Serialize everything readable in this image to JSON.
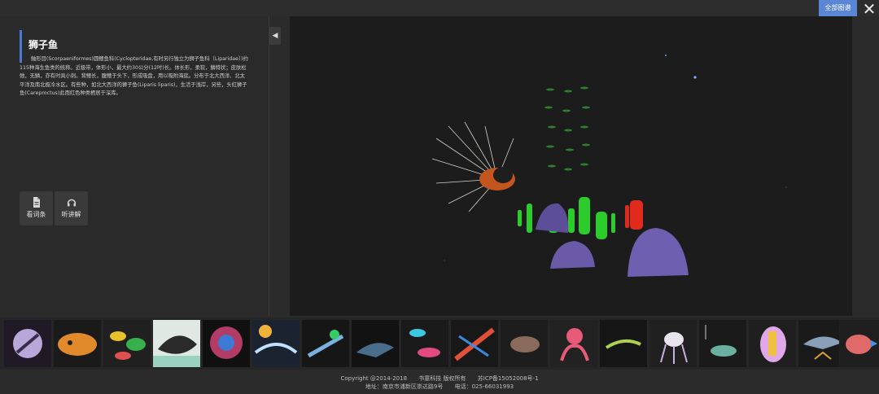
{
  "header": {
    "all_button_label": "全部图谱",
    "close_icon": "close-icon"
  },
  "species": {
    "title": "狮子鱼",
    "description": "鲉形目(Scorpaeniformes)圆鳍鱼科(Cyclopteridae,有时另行独立为狮子鱼科〔Liparidae〕)约115种海生鱼类的统称。近极带，体形小，最大约30公分(12吋)长。体长形，柔软，鳞特状；皮肤松弛，无鳞，亦有时具小刺。背鳍长，腹鳍于头下，形成吸盘，用以吸附海底。分布于北大西洋、北太平洋及南北极冷水区。有些种，如北大西洋的狮子鱼(Liparis liparis)，生活于浅岸，另些，头红狮子鱼(Careproctus)此而红色种类栖居于深库。"
  },
  "actions": [
    {
      "label": "看词条",
      "icon": "document-icon"
    },
    {
      "label": "听讲解",
      "icon": "headphones-icon"
    }
  ],
  "collapse_icon": "chevron-left-icon",
  "thumbnails": [
    "thumb-1",
    "thumb-2",
    "thumb-3",
    "thumb-4",
    "thumb-5",
    "thumb-6",
    "thumb-7",
    "thumb-8",
    "thumb-9",
    "thumb-10",
    "thumb-11",
    "thumb-12",
    "thumb-13",
    "thumb-14",
    "thumb-15",
    "thumb-16",
    "thumb-17",
    "thumb-18"
  ],
  "footer": {
    "copyright": "Copyright @2014-2018",
    "company": "书童科技 版权所有",
    "icp": "苏ICP备15052008号-1",
    "address": "地址：南京市浦新区崇达路9号",
    "phone": "电话：025-66031993"
  },
  "colors": {
    "accent": "#5a86d6",
    "title_bar": "#4a7bd0",
    "next_arrow": "#4a90e2"
  }
}
